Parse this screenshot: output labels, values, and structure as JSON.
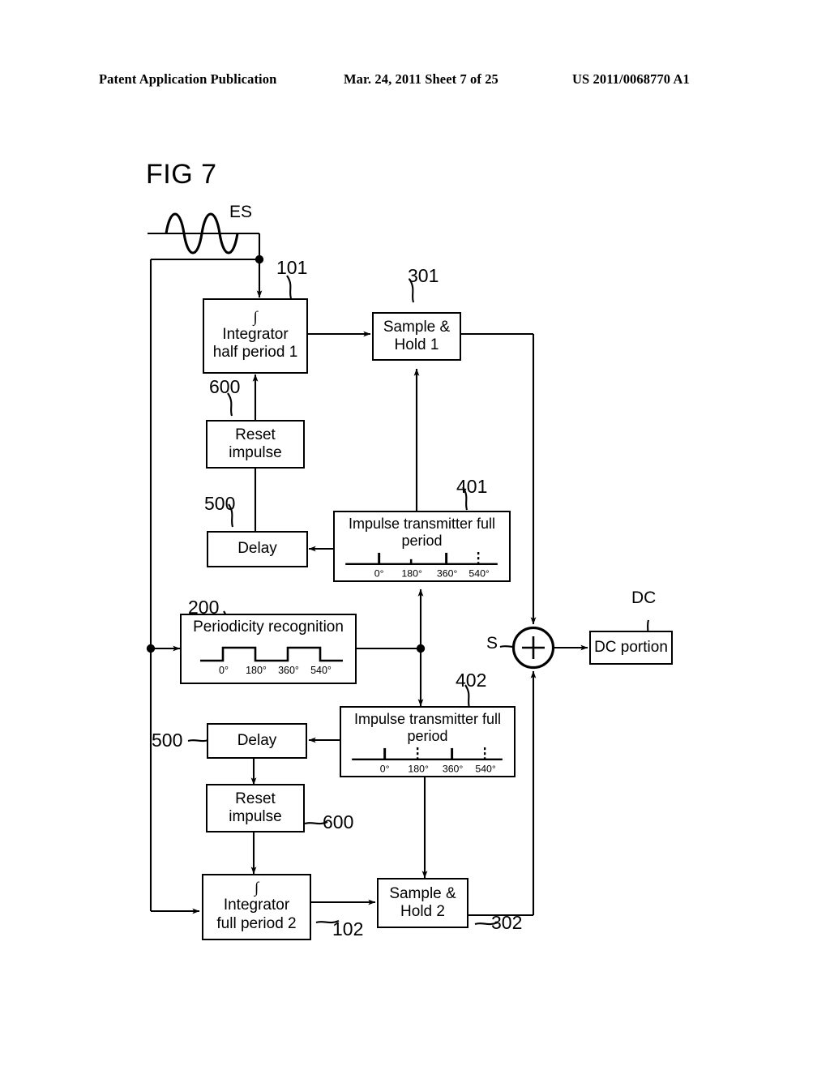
{
  "header": {
    "left": "Patent Application Publication",
    "middle": "Mar. 24, 2011  Sheet 7 of 25",
    "right": "US 2011/0068770 A1"
  },
  "figure": {
    "label": "FIG 7"
  },
  "signals": {
    "input_label": "ES",
    "sum_label": "S",
    "dc_label": "DC"
  },
  "blocks": {
    "integrator1": {
      "ref": "101",
      "symbol": "∫",
      "line1": "Integrator",
      "line2": "half period 1"
    },
    "sample_hold1": {
      "ref": "301",
      "line1": "Sample &",
      "line2": "Hold 1"
    },
    "reset_impulse_top": {
      "ref": "600",
      "line1": "Reset",
      "line2": "impulse"
    },
    "delay_top": {
      "ref": "500",
      "line1": "Delay"
    },
    "impulse_tx_top": {
      "ref": "401",
      "line1": "Impulse transmitter full",
      "line2": "period"
    },
    "periodicity": {
      "ref": "200",
      "line1": "Periodicity recognition"
    },
    "impulse_tx_bottom": {
      "ref": "402",
      "line1": "Impulse transmitter full",
      "line2": "period"
    },
    "delay_bottom": {
      "ref": "500",
      "line1": "Delay"
    },
    "reset_impulse_bottom": {
      "ref": "600",
      "line1": "Reset",
      "line2": "impulse"
    },
    "integrator2": {
      "ref": "102",
      "symbol": "∫",
      "line1": "Integrator",
      "line2": "full period 2"
    },
    "sample_hold2": {
      "ref": "302",
      "line1": "Sample &",
      "line2": "Hold 2"
    },
    "dc_portion": {
      "line1": "DC portion"
    },
    "summer": {
      "symbol": "+"
    }
  },
  "chart_data": {
    "axis_ticks": [
      "0°",
      "180°",
      "360°",
      "540°"
    ],
    "impulse_tx_top": {
      "type": "impulse-train",
      "marks": [
        {
          "at": "0°",
          "style": "solid",
          "height": "tall"
        },
        {
          "at": "180°",
          "style": "solid",
          "height": "short"
        },
        {
          "at": "360°",
          "style": "solid",
          "height": "tall"
        },
        {
          "at": "540°",
          "style": "dashed",
          "height": "tall"
        }
      ]
    },
    "impulse_tx_bottom": {
      "type": "impulse-train",
      "marks": [
        {
          "at": "0°",
          "style": "solid",
          "height": "tall"
        },
        {
          "at": "180°",
          "style": "dashed",
          "height": "tall"
        },
        {
          "at": "360°",
          "style": "solid",
          "height": "tall"
        },
        {
          "at": "540°",
          "style": "dashed",
          "height": "tall"
        }
      ]
    },
    "periodicity": {
      "type": "square-wave",
      "levels": [
        {
          "from": "pre-0°",
          "level": "low"
        },
        {
          "from": "0°",
          "to": "180°",
          "level": "high"
        },
        {
          "from": "180°",
          "to": "360°",
          "level": "low"
        },
        {
          "from": "360°",
          "to": "540°",
          "level": "high"
        },
        {
          "from": "540°",
          "level": "low"
        }
      ]
    },
    "input_waveform": {
      "type": "sine",
      "cycles": 2.5,
      "label": "ES"
    }
  }
}
